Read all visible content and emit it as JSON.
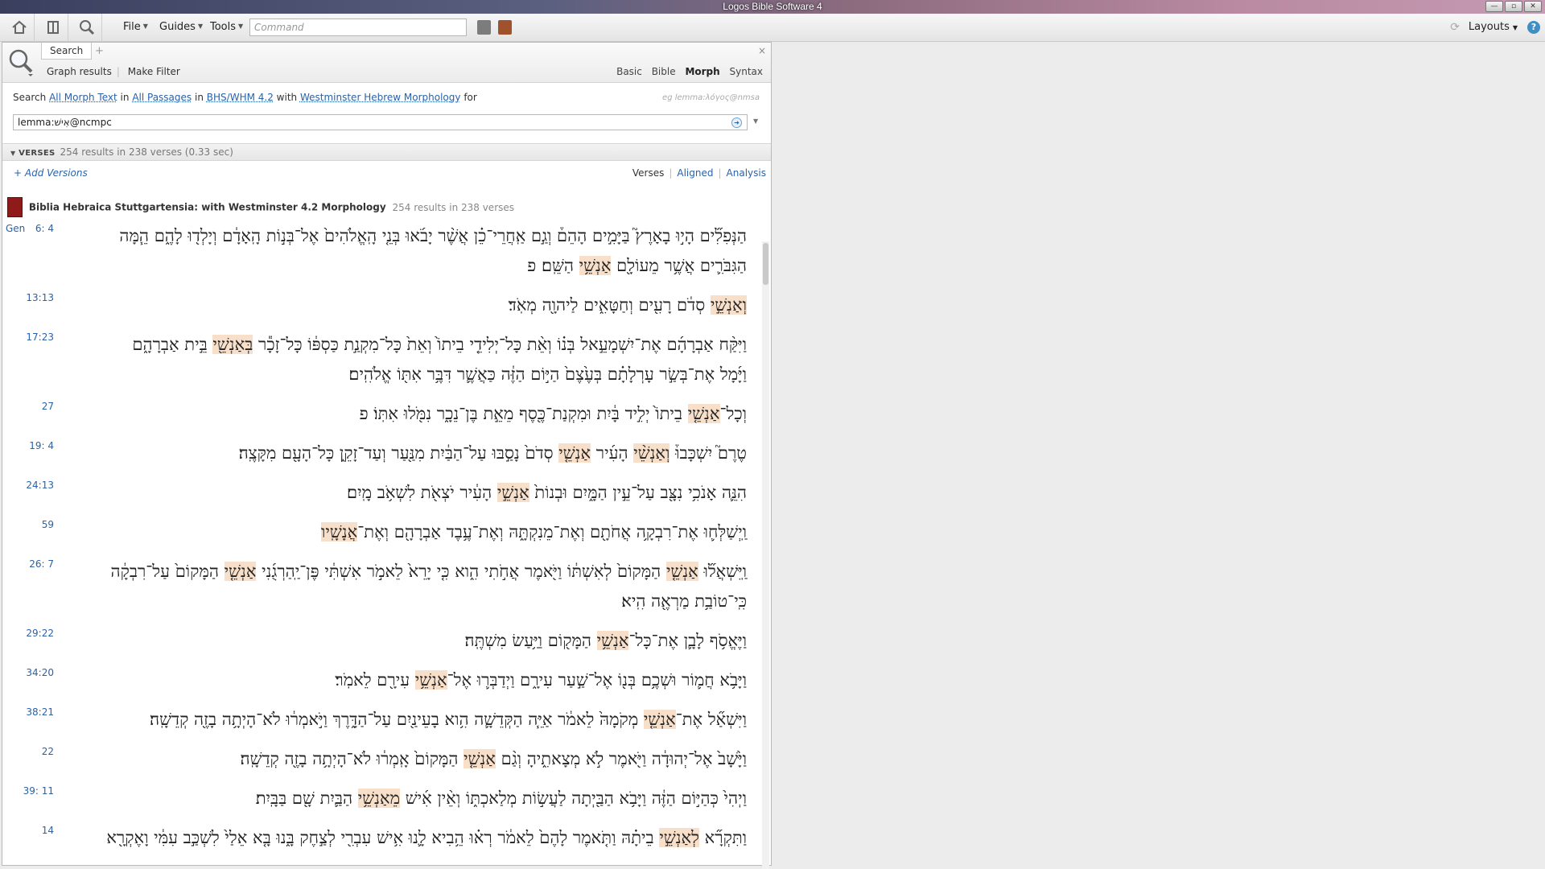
{
  "window": {
    "title": "Logos Bible Software 4"
  },
  "toolbar": {
    "menus": {
      "file": "File",
      "guides": "Guides",
      "tools": "Tools"
    },
    "command_placeholder": "Command",
    "layouts": "Layouts",
    "help": "?"
  },
  "panel": {
    "tab_label": "Search",
    "tab_add": "+",
    "close": "×",
    "links": {
      "graph": "Graph results",
      "filter": "Make Filter"
    },
    "modes": {
      "basic": "Basic",
      "bible": "Bible",
      "morph": "Morph",
      "syntax": "Syntax"
    },
    "search_line": {
      "t1": "Search",
      "scope_text": "All Morph Text",
      "t2": "in",
      "passages": "All Passages",
      "t3": "in",
      "version": "BHS/WHM 4.2",
      "t4": "with",
      "morphology": "Westminster Hebrew Morphology",
      "t5": "for"
    },
    "example_hint": "eg lemma:λόγος@nmsa",
    "query": "lemma:אִישׁ@ncmpc",
    "verses_header": "VERSES",
    "verses_count": "254 results in 238 verses (0.33 sec)",
    "add_versions": "+ Add Versions",
    "views": {
      "verses": "Verses",
      "aligned": "Aligned",
      "analysis": "Analysis"
    },
    "resource_title": "Biblia Hebraica Stuttgartensia: with Westminster 4.2 Morphology",
    "resource_count": "254 results in 238 verses"
  },
  "results": [
    {
      "book": "Gen",
      "ref": "6: 4",
      "lines": [
        [
          "הַנְּפִלִ֞ים הָי֣וּ בָאָרֶץ֮ בַּיָּמִ֣ים הָהֵם֒ וְגַ֣ם אַֽחֲרֵי־כֵ֗ן אֲשֶׁ֨ר יָבֹ֜אוּ בְּנֵ֤י הָֽאֱלֹהִים֙ אֶל־בְּנ֣וֹת הָֽאָדָ֔ם וְיָלְד֖וּ לָהֶ֑ם הֵ֧מָּה"
        ],
        [
          "הַגִּבֹּרִ֛ים אֲשֶׁ֥ר מֵעוֹלָ֖ם ",
          {
            "h": "אַנְשֵׁ֥י"
          },
          " הַשֵּֽׁם׃ פ"
        ]
      ]
    },
    {
      "book": "",
      "ref": "13:13",
      "lines": [
        [
          {
            "h": "וְאַנְשֵׁ֣י"
          },
          " סְדֹ֔ם רָעִ֖ים וְחַטָּאִ֑ים לַיהוָ֖ה מְאֹֽד׃"
        ]
      ]
    },
    {
      "book": "",
      "ref": "17:23",
      "lines": [
        [
          "וַיִּקַּ֨ח אַבְרָהָ֜ם אֶת־יִשְׁמָעֵ֣אל בְּנ֗וֹ וְאֵ֨ת כָּל־יְלִידֵ֤י בֵיתוֹ֙ וְאֵת֙ כָּל־מִקְנַ֣ת כַּסְפּ֔וֹ כָּל־זָכָ֕ר ",
          {
            "h": "בְּאַנְשֵׁ֖י"
          },
          " בֵּ֣ית אַבְרָהָ֑ם"
        ],
        [
          "וַיָּ֜מָל אֶת־בְּשַׂ֣ר עָרְלָתָ֗ם בְּעֶ֙צֶם֙ הַיּ֣וֹם הַזֶּ֔ה כַּאֲשֶׁ֛ר דִּבֶּ֥ר אִתּ֖וֹ אֱלֹהִֽים׃"
        ]
      ]
    },
    {
      "book": "",
      "ref": "27",
      "lines": [
        [
          "וְכָל־",
          {
            "h": "אַנְשֵׁ֤י"
          },
          " בֵיתוֹ֙ יְלִ֣יד בָּ֔יִת וּמִקְנַת־כֶּ֖סֶף מֵאֵ֣ת בֶּן־נֵכָ֑ר נִמֹּ֖לוּ אִתּֽוֹ׃ פ"
        ]
      ]
    },
    {
      "book": "",
      "ref": "19: 4",
      "lines": [
        [
          "טֶרֶם֮ יִשְׁכָּבוּ֒ ",
          {
            "h": "וְאַנְשֵׁ֨י"
          },
          " הָעִ֜יר ",
          {
            "h": "אַנְשֵׁ֤י"
          },
          " סְדֹם֙ נָסַ֣בּוּ עַל־הַבַּ֔יִת מִנַּ֖עַר וְעַד־זָקֵ֑ן כָּל־הָעָ֖ם מִקָּצֶֽה׃"
        ]
      ]
    },
    {
      "book": "",
      "ref": "24:13",
      "lines": [
        [
          "הִנֵּ֛ה אָנֹכִ֥י נִצָּ֖ב עַל־עֵ֣ין הַמָּ֑יִם וּבְנוֹת֙ ",
          {
            "h": "אַנְשֵׁ֣י"
          },
          " הָעִ֔יר יֹצְאֹ֖ת לִשְׁאֹ֥ב מָֽיִם׃"
        ]
      ]
    },
    {
      "book": "",
      "ref": "59",
      "lines": [
        [
          "וַֽיְשַׁלְּח֛וּ אֶת־רִבְקָ֥ה אֲחֹתָ֖ם וְאֶת־מֵנִקְתָּ֑הּ וְאֶת־עֶ֥בֶד אַבְרָהָ֖ם וְאֶת־",
          {
            "h": "אֲנָשָֽׁיו"
          },
          "׃"
        ]
      ]
    },
    {
      "book": "",
      "ref": "26: 7",
      "lines": [
        [
          "וַֽיִּשְׁאֲל֞וּ ",
          {
            "h": "אַנְשֵׁ֤י"
          },
          " הַמָּקוֹם֙ לְאִשְׁתּ֔וֹ וַיֹּ֖אמֶר אֲחֹ֣תִי הִ֑וא כִּ֤י יָרֵא֙ לֵאמֹ֣ר אִשְׁתִּ֔י פֶּן־יַֽהַרְגֻ֜נִי ",
          {
            "h": "אַנְשֵׁ֤י"
          },
          " הַמָּקוֹם֙ עַל־רִבְקָ֔ה"
        ],
        [
          "כִּֽי־טוֹבַ֥ת מַרְאֶ֖ה הִֽיא׃"
        ]
      ]
    },
    {
      "book": "",
      "ref": "29:22",
      "lines": [
        [
          "וַיֶּאֱסֹ֥ף לָבָ֛ן אֶת־כָּל־",
          {
            "h": "אַנְשֵׁ֥י"
          },
          " הַמָּק֖וֹם וַיַּ֥עַשׂ מִשְׁתֶּֽה׃"
        ]
      ]
    },
    {
      "book": "",
      "ref": "34:20",
      "lines": [
        [
          "וַיָּבֹ֥א חֲמ֛וֹר וּשְׁכֶ֥ם בְּנ֖וֹ אֶל־שַׁ֣עַר עִירָ֑ם וַיְדַבְּר֛וּ אֶל־",
          {
            "h": "אַנְשֵׁ֥י"
          },
          " עִירָ֖ם לֵאמֹֽר׃"
        ]
      ]
    },
    {
      "book": "",
      "ref": "38:21",
      "lines": [
        [
          "וַיִּשְׁאַ֞ל אֶת־",
          {
            "h": "אַנְשֵׁ֤י"
          },
          " מְקֹמָהּ֙ לֵאמֹ֔ר אַיֵּ֧ה הַקְּדֵשָׁ֛ה הִ֥וא בָעֵינַ֖יִם עַל־הַדָּ֑רֶךְ וַיֹּ֣אמְר֔וּ לֹא־הָיְתָ֥ה בָזֶ֖ה קְדֵשָֽׁה׃"
        ]
      ]
    },
    {
      "book": "",
      "ref": "22",
      "lines": [
        [
          "וַיָּ֙שָׁב֙ אֶל־יְהוּדָ֔ה וַיֹּ֖אמֶר לֹ֣א מְצָאתִ֑יהָ וְגַ֨ם ",
          {
            "h": "אַנְשֵׁ֤י"
          },
          " הַמָּקוֹם֙ אָֽמְר֔וּ לֹא־הָיְתָ֥ה בָזֶ֖ה קְדֵשָֽׁה׃"
        ]
      ]
    },
    {
      "book": "",
      "ref": "39: 11",
      "lines": [
        [
          "וַיְהִי֙ כְּהַיּ֣וֹם הַזֶּ֔ה וַיָּבֹ֥א הַבַּ֖יְתָה לַעֲשׂ֣וֹת מְלַאכְתּ֑וֹ וְאֵ֨ין אִ֜ישׁ ",
          {
            "h": "מֵאַנְשֵׁ֥י"
          },
          " הַבַּ֛יִת שָׁ֖ם בַּבָּֽיִת׃"
        ]
      ]
    },
    {
      "book": "",
      "ref": "14",
      "lines": [
        [
          "וַתִּקְרָ֞א ",
          {
            "h": "לְאַנְשֵׁ֣י"
          },
          " בֵיתָ֗הּ וַתֹּ֤אמֶר לָהֶם֙ לֵאמֹ֔ר רְא֗וּ הֵ֥בִיא לָ֛נוּ אִ֥ישׁ עִבְרִ֖י לְצַ֣חֶק בָּ֑נוּ בָּ֤א אֵלַי֙ לִשְׁכַּ֣ב עִמִּ֔י וָאֶקְרָ֖א"
        ]
      ]
    }
  ]
}
